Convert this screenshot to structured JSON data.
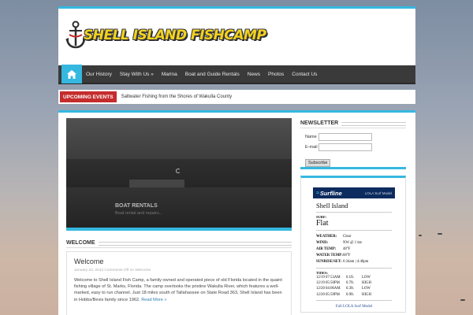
{
  "site": {
    "logo_text": "SHELL ISLAND FISHCAMP",
    "accent_color": "#35b8e0"
  },
  "nav": {
    "home_icon": "home-icon",
    "items": [
      {
        "label": "Our History"
      },
      {
        "label": "Stay With Us »"
      },
      {
        "label": "Marina"
      },
      {
        "label": "Boat and Guide Rentals"
      },
      {
        "label": "News"
      },
      {
        "label": "Photos"
      },
      {
        "label": "Contact Us"
      }
    ]
  },
  "ticker": {
    "label": "Upcoming Events",
    "text": "Saltwater Fishing from the Shores of Wakulla County"
  },
  "slider": {
    "title": "BOAT RENTALS",
    "subtitle": "Boat rental and repairs..."
  },
  "welcome_section": {
    "heading": "Welcome",
    "post_title": "Welcome",
    "meta": "January 23, 2013 Comments Off on Welcome",
    "body": "Welcome to Shell Island Fish Camp, a family owned and operated piece of old Florida located in the quaint fishing village of St. Marks, Florida. The camp overlooks the pristine Wakulla River, which features a well-marked, easy to run channel. Just 18 miles south of Tallahassee on State Road 363, Shell Island has been in Hobbs/Bevis family since 1962.",
    "read_more": "Read More »"
  },
  "newsletter": {
    "heading": "Newsletter",
    "name_label": "Name",
    "email_label": "E-mail",
    "subscribe_label": "Subscribe"
  },
  "surf": {
    "brand": "Surfline",
    "model": "LOLA Surf Model",
    "spot": "Shell Island",
    "surf_label": "SURF:",
    "surf_value": "Flat",
    "conditions": [
      {
        "key": "WEATHER:",
        "value": "Clear"
      },
      {
        "key": "WIND:",
        "value": "NW @ 1 kts"
      },
      {
        "key": "AIR TEMP:",
        "value": "48°F"
      },
      {
        "key": "WATER TEMP:",
        "value": "68°F"
      },
      {
        "key": "SUNRISE/SET:",
        "value": "6:34am | 4:46pm"
      }
    ],
    "tides_label": "TIDES:",
    "tides": [
      {
        "date": "12/19",
        "time": "07:53AM",
        "height": "0.1ft.",
        "level": "LOW"
      },
      {
        "date": "12/19",
        "time": "05:50PM",
        "height": "0.7ft.",
        "level": "HIGH"
      },
      {
        "date": "12/20",
        "time": "04:06AM",
        "height": "0.3ft.",
        "level": "LOW"
      },
      {
        "date": "12/20",
        "time": "05:59PM",
        "height": "0.9ft.",
        "level": "HIGH"
      }
    ],
    "link_text": "Full LOLA Surf Model"
  }
}
